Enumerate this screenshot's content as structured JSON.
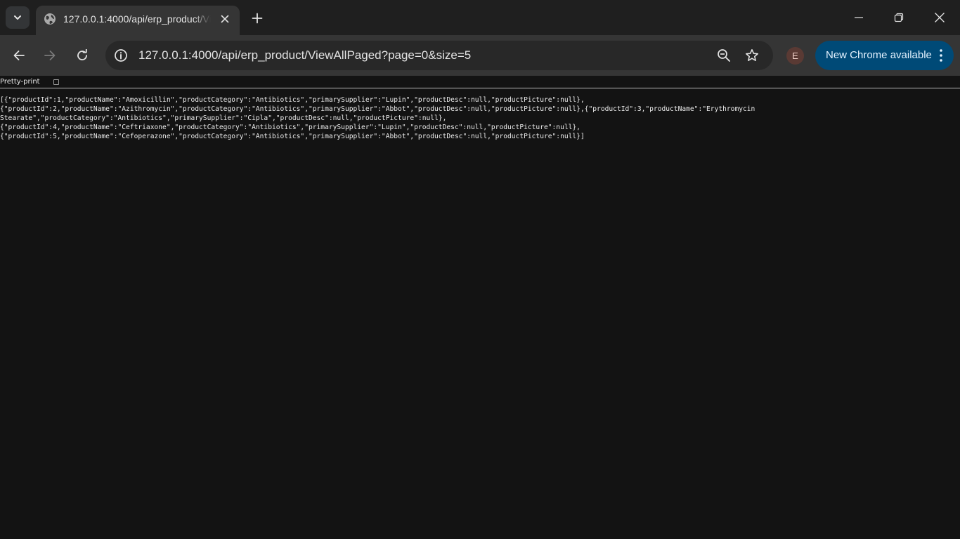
{
  "tab": {
    "title": "127.0.0.1:4000/api/erp_product/ViewAllPaged?page=0&size=5"
  },
  "toolbar": {
    "url": "127.0.0.1:4000/api/erp_product/ViewAllPaged?page=0&size=5",
    "profile_initial": "E",
    "update_label": "New Chrome available"
  },
  "viewer": {
    "pretty_print_label": "Pretty-print",
    "pretty_print_checked": false,
    "lines": [
      "[{\"productId\":1,\"productName\":\"Amoxicillin\",\"productCategory\":\"Antibiotics\",\"primarySupplier\":\"Lupin\",\"productDesc\":null,\"productPicture\":null},",
      "{\"productId\":2,\"productName\":\"Azithromycin\",\"productCategory\":\"Antibiotics\",\"primarySupplier\":\"Abbot\",\"productDesc\":null,\"productPicture\":null},{\"productId\":3,\"productName\":\"Erythromycin",
      "Stearate\",\"productCategory\":\"Antibiotics\",\"primarySupplier\":\"Cipla\",\"productDesc\":null,\"productPicture\":null},",
      "{\"productId\":4,\"productName\":\"Ceftriaxone\",\"productCategory\":\"Antibiotics\",\"primarySupplier\":\"Lupin\",\"productDesc\":null,\"productPicture\":null},",
      "{\"productId\":5,\"productName\":\"Cefoperazone\",\"productCategory\":\"Antibiotics\",\"primarySupplier\":\"Abbot\",\"productDesc\":null,\"productPicture\":null}]"
    ]
  },
  "colors": {
    "page_background": "#131313",
    "tabstrip": "#1f1f1f",
    "toolbar": "#353535",
    "omnibox": "#282828",
    "update_chip": "#004a77"
  }
}
